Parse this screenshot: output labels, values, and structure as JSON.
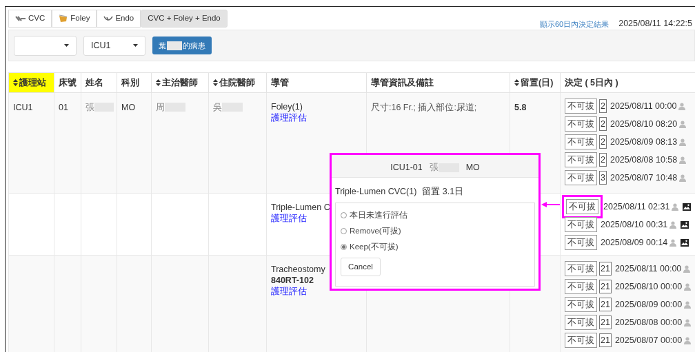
{
  "tabs": [
    {
      "label": "CVC",
      "kind": "cvc",
      "selected": false
    },
    {
      "label": "Foley",
      "kind": "foley",
      "selected": false
    },
    {
      "label": "Endo",
      "kind": "endo",
      "selected": false
    },
    {
      "label": "CVC + Foley + Endo",
      "selected": true
    }
  ],
  "history_link": "顯示60日內決定結果",
  "timestamp": "2025/08/11 14:22:5",
  "filters": {
    "unit": "ICU1",
    "patient_button": {
      "before": "葉",
      "after": "的病患"
    }
  },
  "columns": [
    {
      "label": "護理站",
      "sortable": true,
      "highlighted": true
    },
    {
      "label": "床號",
      "sortable": false,
      "highlighted": false
    },
    {
      "label": "姓名",
      "sortable": false,
      "highlighted": false
    },
    {
      "label": "科別",
      "sortable": false,
      "highlighted": false
    },
    {
      "label": "主治醫師",
      "sortable": true,
      "highlighted": false
    },
    {
      "label": "住院醫師",
      "sortable": true,
      "highlighted": false
    },
    {
      "label": "導管",
      "sortable": false,
      "highlighted": false
    },
    {
      "label": "導管資訊及備註",
      "sortable": false,
      "highlighted": false
    },
    {
      "label": "留置(日)",
      "sortable": true,
      "highlighted": false
    },
    {
      "label": "決定 ( 5日內 )",
      "sortable": false,
      "highlighted": false
    }
  ],
  "rows": [
    {
      "station": "ICU1",
      "bed": "01",
      "name": "張",
      "dept": "MO",
      "attending": "周",
      "resident": "吳",
      "catheter": "Foley(1)",
      "link": "護理評估",
      "info": "尺寸:16 Fr.; 插入部位:尿道;",
      "days": "5.8",
      "decisions": [
        {
          "verdict": "不可拔",
          "count": "2",
          "time": "2025/08/11 00:00",
          "highlighted": false
        },
        {
          "verdict": "不可拔",
          "count": "2",
          "time": "2025/08/10 08:20",
          "highlighted": false
        },
        {
          "verdict": "不可拔",
          "count": "2",
          "time": "2025/08/09 08:13",
          "highlighted": false
        },
        {
          "verdict": "不可拔",
          "count": "2",
          "time": "2025/08/08 10:58",
          "highlighted": false
        },
        {
          "verdict": "不可拔",
          "count": "3",
          "time": "2025/08/07 10:48",
          "highlighted": false
        }
      ]
    },
    {
      "catheter": "Triple-Lumen C",
      "link": "護理評估",
      "decisions": [
        {
          "verdict": "不可拔",
          "time": "2025/08/11 02:31",
          "image": true,
          "highlighted": true
        },
        {
          "verdict": "不可拔",
          "time": "2025/08/10 00:31",
          "image": true,
          "highlighted": false
        },
        {
          "verdict": "不可拔",
          "time": "2025/08/09 00:14",
          "image": true,
          "highlighted": false
        }
      ]
    },
    {
      "catheter": "Tracheostomy",
      "code": "840RT-102",
      "link": "護理評估",
      "decisions": [
        {
          "verdict": "不可拔",
          "count": "21",
          "time": "2025/08/11 00:00",
          "highlighted": false
        },
        {
          "verdict": "不可拔",
          "count": "21",
          "time": "2025/08/10 00:00",
          "highlighted": false
        },
        {
          "verdict": "不可拔",
          "count": "21",
          "time": "2025/08/09 00:00",
          "highlighted": false
        },
        {
          "verdict": "不可拔",
          "count": "21",
          "time": "2025/08/08 00:00",
          "highlighted": false
        },
        {
          "verdict": "不可拔",
          "count": "21",
          "time": "2025/08/07 00:00",
          "highlighted": false
        }
      ]
    }
  ],
  "dialog": {
    "bed": "ICU1-01",
    "name": "張",
    "dept": "MO",
    "catheter": "Triple-Lumen CVC(1)",
    "duration": "留置 3.1日",
    "options": [
      {
        "label": "本日未進行評估",
        "selected": false
      },
      {
        "label": "Remove(可拔)",
        "selected": false
      },
      {
        "label": "Keep(不可拔)",
        "selected": true
      }
    ],
    "cancel": "Cancel"
  }
}
